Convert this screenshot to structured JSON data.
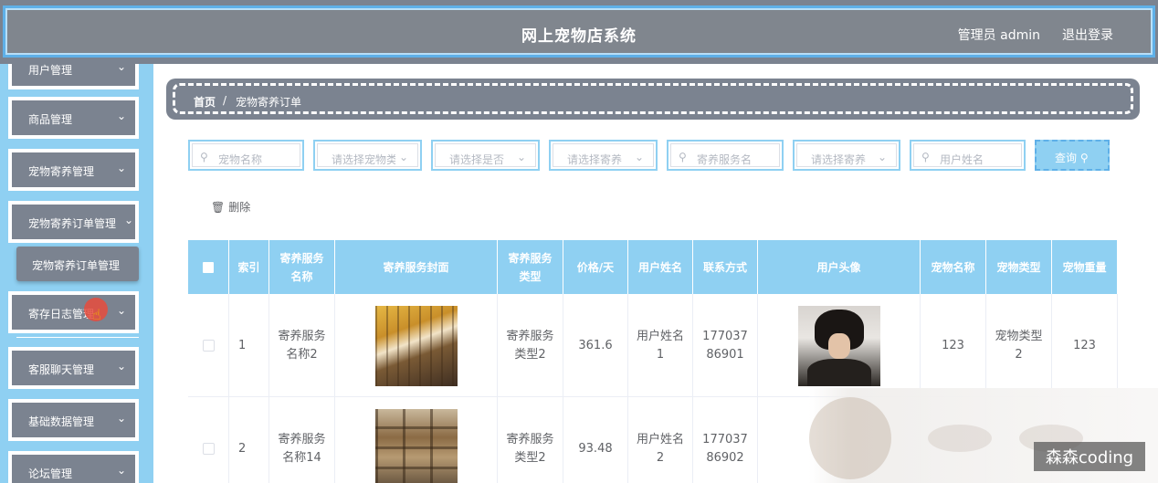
{
  "header": {
    "title": "网上宠物店系统",
    "user_label": "管理员 admin",
    "logout_label": "退出登录"
  },
  "sidebar": {
    "items": [
      {
        "label": "用户管理",
        "chevron": "chevron-down-icon"
      },
      {
        "label": "商品管理"
      },
      {
        "label": "宠物寄养管理"
      },
      {
        "label": "宠物寄养订单管理"
      },
      {
        "label": "寄存日志管理"
      },
      {
        "label": "客服聊天管理"
      },
      {
        "label": "基础数据管理"
      },
      {
        "label": "论坛管理"
      }
    ],
    "submenu": {
      "label": "宠物寄养订单管理"
    },
    "chevron": "⌄"
  },
  "breadcrumb": {
    "home": "首页",
    "separator": "/",
    "current": "宠物寄养订单"
  },
  "filters": {
    "pet_name": "宠物名称",
    "pet_type": "请选择宠物类",
    "is_flag": "请选择是否",
    "service_type": "请选择寄养",
    "service_name": "寄养服务名",
    "status": "请选择寄养",
    "user_name": "用户姓名",
    "search_icon": "⚲",
    "chevron": "⌄"
  },
  "query_button": "查询 ⚲",
  "delete_button": {
    "icon": "🗑",
    "label": "删除"
  },
  "table": {
    "headers": {
      "index": "索引",
      "service_name": "寄养服务名称",
      "cover": "寄养服务封面",
      "service_type": "寄养服务类型",
      "price": "价格/天",
      "user_name": "用户姓名",
      "contact": "联系方式",
      "avatar": "用户头像",
      "pet_name": "宠物名称",
      "pet_type": "宠物类型",
      "pet_weight": "宠物重量"
    },
    "rows": [
      {
        "index": "1",
        "service_name": "寄养服务名称2",
        "service_type": "寄养服务类型2",
        "price": "361.6",
        "user_name": "用户姓名1",
        "contact": "17703786901",
        "pet_name": "123",
        "pet_type": "宠物类型2",
        "pet_weight": "123"
      },
      {
        "index": "2",
        "service_name": "寄养服务名称14",
        "service_type": "寄养服务类型2",
        "price": "93.48",
        "user_name": "用户姓名2",
        "contact": "17703786902"
      }
    ]
  },
  "watermark": "森森coding"
}
